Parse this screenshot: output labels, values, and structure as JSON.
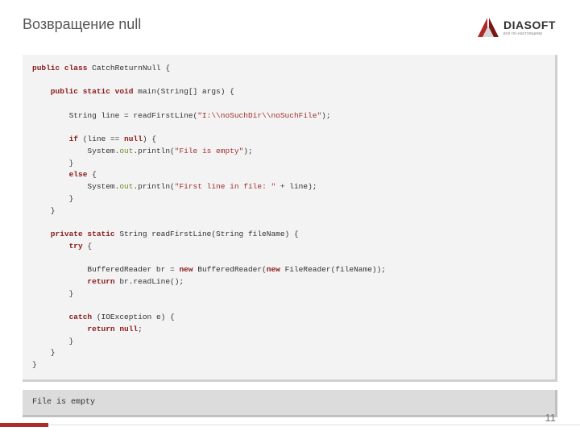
{
  "header": {
    "title": "Возвращение null",
    "logo_text": "DIASOFT",
    "logo_sub": "всё по-настоящему"
  },
  "code": {
    "l01a": "public class",
    "l01b": " CatchReturnNull {",
    "l02": "",
    "l03a": "    public static void",
    "l03b": " main(String[] args) {",
    "l04": "",
    "l05a": "        String line = readFirstLine(",
    "l05b": "\"I:\\\\noSuchDir\\\\noSuchFile\"",
    "l05c": ");",
    "l06": "",
    "l07a": "        if",
    "l07b": " (line == ",
    "l07c": "null",
    "l07d": ") {",
    "l08a": "            System.",
    "l08b": "out",
    "l08c": ".println(",
    "l08d": "\"File is empty\"",
    "l08e": ");",
    "l09": "        }",
    "l10a": "        else",
    "l10b": " {",
    "l11a": "            System.",
    "l11b": "out",
    "l11c": ".println(",
    "l11d": "\"First line in file: \"",
    "l11e": " + line);",
    "l12": "        }",
    "l13": "    }",
    "l14": "",
    "l15a": "    private static",
    "l15b": " String readFirstLine(String fileName) {",
    "l16a": "        try",
    "l16b": " {",
    "l17": "",
    "l18a": "            BufferedReader br = ",
    "l18b": "new",
    "l18c": " BufferedReader(",
    "l18d": "new",
    "l18e": " FileReader(fileName));",
    "l19a": "            return",
    "l19b": " br.readLine();",
    "l20": "        }",
    "l21": "",
    "l22a": "        catch",
    "l22b": " (IOException e) {",
    "l23a": "            return null",
    "l23b": ";",
    "l24": "        }",
    "l25": "    }",
    "l26": "}"
  },
  "output": "File is empty",
  "page_number": "11"
}
